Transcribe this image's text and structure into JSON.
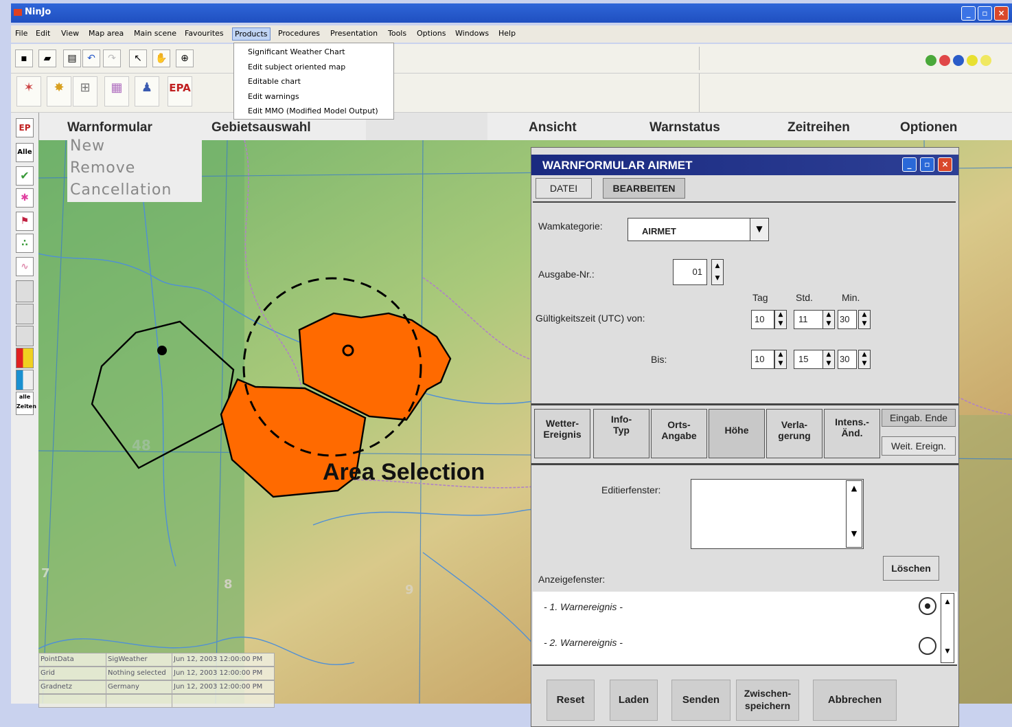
{
  "window": {
    "title": "NinJo"
  },
  "menu": [
    "File",
    "Edit",
    "View",
    "Map area",
    "Main scene",
    "Favourites",
    "Products",
    "Procedures",
    "Presentation",
    "Tools",
    "Options",
    "Windows",
    "Help"
  ],
  "products_menu": [
    "Significant Weather Chart",
    "Edit subject oriented map",
    "Editable chart",
    "Edit warnings",
    "Edit MMO (Modified Model Output)"
  ],
  "header_tabs": [
    "Warnformular",
    "Gebietsauswahl",
    "Ansicht",
    "Warnstatus",
    "Zeitreihen",
    "Optionen"
  ],
  "left_tools": [
    "Alle",
    "alle Zeiten"
  ],
  "context_menu": [
    "New",
    "Remove",
    "Cancellation"
  ],
  "map": {
    "annotation": "Area Selection",
    "labels": [
      "48",
      "8",
      "9",
      "7"
    ]
  },
  "status_table": [
    [
      "PointData",
      "SigWeather",
      "Jun 12, 2003 12:00:00 PM"
    ],
    [
      "Grid",
      "Nothing selected",
      "Jun 12, 2003 12:00:00 PM"
    ],
    [
      "Gradnetz",
      "Germany",
      "Jun 12, 2003 12:00:00 PM"
    ]
  ],
  "dialog": {
    "title": "WARNFORMULAR AIRMET",
    "menu": [
      "DATEI",
      "BEARBEITEN"
    ],
    "category_label": "Wamkategorie:",
    "category_value": "AIRMET",
    "issue_label": "Ausgabe-Nr.:",
    "issue_value": "01",
    "col_tag": "Tag",
    "col_std": "Std.",
    "col_min": "Min.",
    "valid_label": "Gültigkeitszeit (UTC)  von:",
    "from": {
      "tag": "10",
      "std": "11",
      "min": "30"
    },
    "to_label": "Bis:",
    "to": {
      "tag": "10",
      "std": "15",
      "min": "30"
    },
    "tabs": [
      [
        "Wetter-",
        "Ereignis"
      ],
      [
        "Info-",
        "Typ"
      ],
      [
        "Orts-",
        "Angabe"
      ],
      [
        "Höhe",
        ""
      ],
      [
        "Verla-",
        "gerung"
      ],
      [
        "Intens.-",
        "Änd."
      ]
    ],
    "side_buttons": [
      "Eingab. Ende",
      "Weit. Ereign."
    ],
    "edit_label": "Editierfenster:",
    "delete_button": "Löschen",
    "display_label": "Anzeigefenster:",
    "events": [
      "- 1. Warnereignis -",
      "- 2. Warnereignis -"
    ],
    "buttons": [
      "Reset",
      "Laden",
      "Senden",
      "Zwischen-\nspeichern",
      "Abbrechen"
    ]
  }
}
